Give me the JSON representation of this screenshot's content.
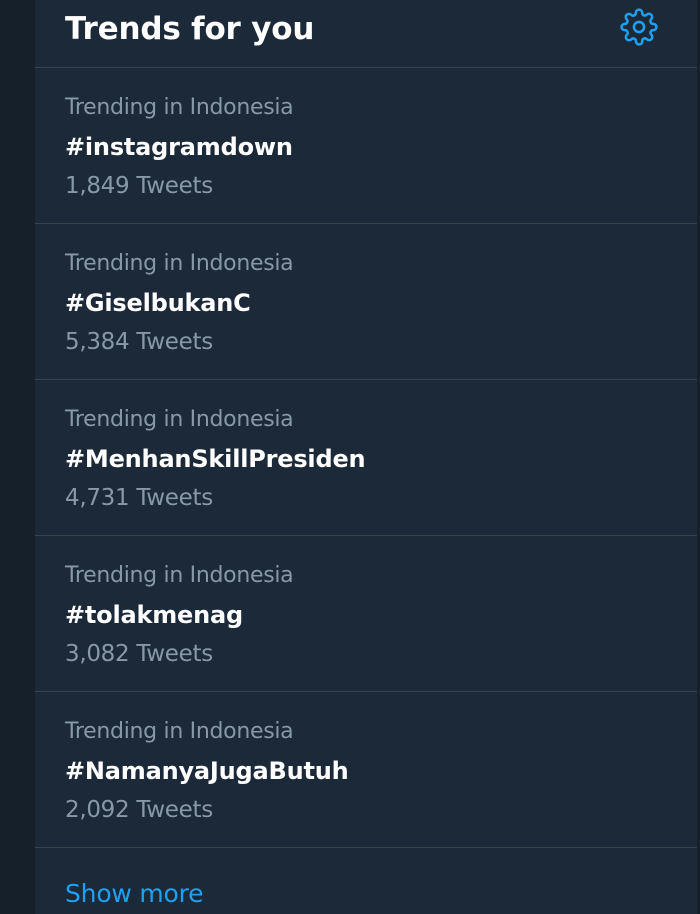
{
  "header": {
    "title": "Trends for you",
    "settings_icon": "gear-icon"
  },
  "colors": {
    "background": "#15202b",
    "panel": "#1c2938",
    "divider": "#38444d",
    "primary_text": "#ffffff",
    "secondary_text": "#8899a6",
    "accent": "#1da1f2"
  },
  "trends": [
    {
      "context": "Trending in Indonesia",
      "name": "#instagramdown",
      "count": "1,849 Tweets"
    },
    {
      "context": "Trending in Indonesia",
      "name": "#GiselbukanC",
      "count": "5,384 Tweets"
    },
    {
      "context": "Trending in Indonesia",
      "name": "#MenhanSkillPresiden",
      "count": "4,731 Tweets"
    },
    {
      "context": "Trending in Indonesia",
      "name": "#tolakmenag",
      "count": "3,082 Tweets"
    },
    {
      "context": "Trending in Indonesia",
      "name": "#NamanyaJugaButuh",
      "count": "2,092 Tweets"
    }
  ],
  "footer": {
    "show_more_label": "Show more"
  }
}
